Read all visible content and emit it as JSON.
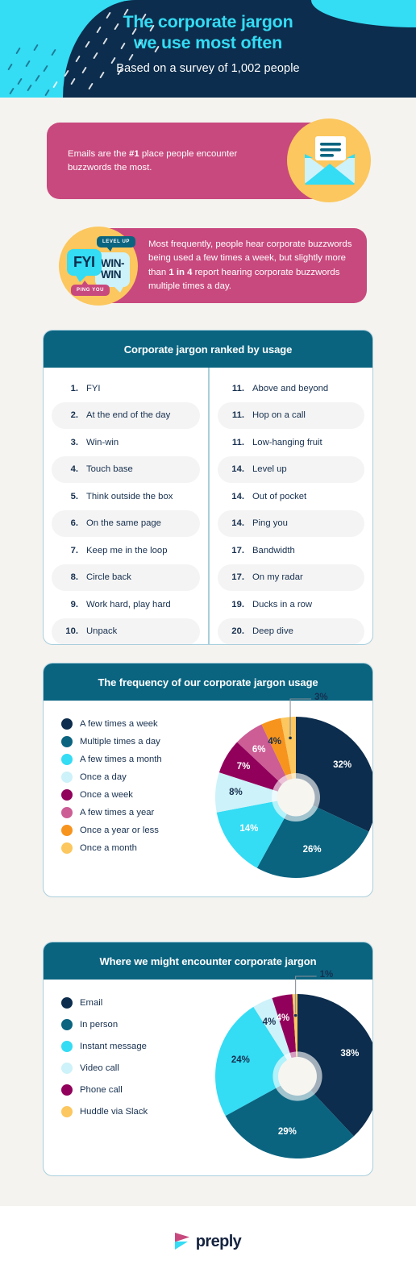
{
  "header": {
    "title_line1": "The corporate jargon",
    "title_line2": "we use most often",
    "subtitle": "Based on a survey of 1,002 people",
    "accent_color": "#34dcf4",
    "background_color": "#0c2d4d"
  },
  "banner_email": {
    "text_part1": "Emails are the ",
    "highlight": "#1",
    "text_part2": " place people encounter buzzwords the most.",
    "background_color": "#c8497e",
    "icon": "email-envelope-icon",
    "icon_circle_color": "#fbc75e"
  },
  "banner_frequency": {
    "text_part1": "Most frequently, people hear corporate buzzwords being used a few times a week, but slightly more than ",
    "highlight": "1 in 4",
    "text_part2": " report hearing corporate buzzwords multiple times a day.",
    "background_color": "#c8497e",
    "bubbles": [
      {
        "label": "LEVEL UP",
        "color": "#0a6480"
      },
      {
        "label": "FYI",
        "color": "#34dcf4"
      },
      {
        "label": "WIN-\nWIN",
        "color": "#cdf2f9"
      },
      {
        "label": "PING YOU",
        "color": "#c8497e"
      }
    ]
  },
  "ranked_list": {
    "title": "Corporate jargon ranked by usage",
    "header_color": "#0a6480",
    "left_column": [
      {
        "rank": "1.",
        "term": "FYI"
      },
      {
        "rank": "2.",
        "term": "At the end of the day"
      },
      {
        "rank": "3.",
        "term": "Win-win"
      },
      {
        "rank": "4.",
        "term": "Touch base"
      },
      {
        "rank": "5.",
        "term": "Think outside the box"
      },
      {
        "rank": "6.",
        "term": "On the same page"
      },
      {
        "rank": "7.",
        "term": "Keep me in the loop"
      },
      {
        "rank": "8.",
        "term": "Circle back"
      },
      {
        "rank": "9.",
        "term": "Work hard, play hard"
      },
      {
        "rank": "10.",
        "term": "Unpack"
      }
    ],
    "right_column": [
      {
        "rank": "11.",
        "term": "Above and beyond"
      },
      {
        "rank": "11.",
        "term": "Hop on a call"
      },
      {
        "rank": "11.",
        "term": "Low-hanging fruit"
      },
      {
        "rank": "14.",
        "term": "Level up"
      },
      {
        "rank": "14.",
        "term": "Out of pocket"
      },
      {
        "rank": "14.",
        "term": "Ping you"
      },
      {
        "rank": "17.",
        "term": "Bandwidth"
      },
      {
        "rank": "17.",
        "term": "On my radar"
      },
      {
        "rank": "19.",
        "term": "Ducks in a row"
      },
      {
        "rank": "20.",
        "term": "Deep dive"
      }
    ]
  },
  "footer": {
    "logo_text": "preply"
  },
  "chart_data": [
    {
      "type": "pie",
      "title": "The frequency of our corporate jargon usage",
      "legend_position": "left",
      "categories": [
        "A few times a week",
        "Multiple times a day",
        "A few times a month",
        "Once a day",
        "Once a week",
        "A few times a year",
        "Once a year or less",
        "Once a month"
      ],
      "values": [
        32,
        26,
        14,
        8,
        7,
        6,
        4,
        3
      ],
      "labels": [
        "32%",
        "26%",
        "14%",
        "8%",
        "7%",
        "6%",
        "4%",
        "3%"
      ],
      "colors": [
        "#0c2d4d",
        "#0a6480",
        "#34dcf4",
        "#cdf2f9",
        "#91005b",
        "#cc5d95",
        "#f7941d",
        "#fbc75e"
      ],
      "label_text_colors": [
        "#ffffff",
        "#ffffff",
        "#ffffff",
        "#17304f",
        "#ffffff",
        "#ffffff",
        "#17304f",
        "#17304f"
      ],
      "callout_index": 7,
      "units": "percent"
    },
    {
      "type": "pie",
      "title": "Where we might encounter corporate jargon",
      "legend_position": "left",
      "categories": [
        "Email",
        "In person",
        "Instant message",
        "Video call",
        "Phone call",
        "Huddle via Slack"
      ],
      "values": [
        38,
        29,
        24,
        4,
        4,
        1
      ],
      "labels": [
        "38%",
        "29%",
        "24%",
        "4%",
        "4%",
        "1%"
      ],
      "colors": [
        "#0c2d4d",
        "#0a6480",
        "#34dcf4",
        "#cdf2f9",
        "#91005b",
        "#fbc75e"
      ],
      "label_text_colors": [
        "#ffffff",
        "#ffffff",
        "#17304f",
        "#17304f",
        "#ffffff",
        "#17304f"
      ],
      "callout_index": 5,
      "units": "percent"
    }
  ]
}
